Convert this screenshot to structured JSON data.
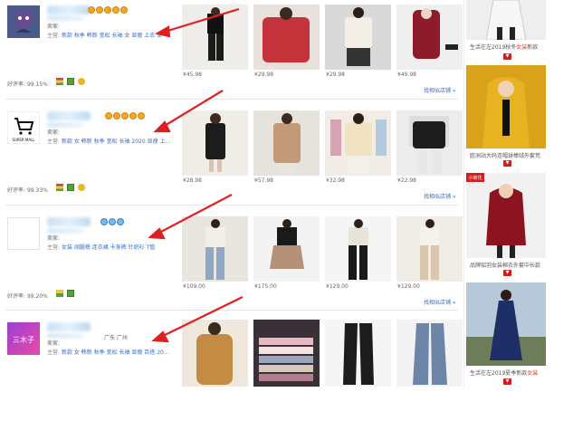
{
  "shops": [
    {
      "seller_label": "卖家:",
      "main_label": "主营:",
      "main_keywords": "新款 秋季 韩新 宽松 长袖 女 显瘦 上衣 女",
      "rating_label": "好评率:",
      "rating_value": "99.15%",
      "location": "",
      "more_link": "",
      "prices": [
        "¥45.98",
        "¥29.98",
        "¥29.98",
        "¥49.98"
      ]
    },
    {
      "seller_label": "卖家:",
      "main_label": "主营:",
      "main_keywords": "新款 女 韩新 秋季 宽松 长袖 2020 显瘦 上...",
      "rating_label": "好评率:",
      "rating_value": "99.33%",
      "location": "",
      "more_link": "找相似店铺 »",
      "prices": [
        "¥28.98",
        "¥57.98",
        "¥32.98",
        "¥22.98"
      ]
    },
    {
      "seller_label": "卖家:",
      "main_label": "主营:",
      "main_keywords": "女装 阔腿裤 连衣裙 卡身裤 针织衫 T恤",
      "rating_label": "好评率:",
      "rating_value": "99.20%",
      "location": "",
      "more_link": "找相似店铺 »",
      "prices": [
        "¥109.00",
        "¥175.00",
        "¥129.00",
        "¥129.00"
      ]
    },
    {
      "seller_label": "卖家:",
      "main_label": "主营:",
      "main_keywords": "新款 女 韩新 秋季 宽松 长袖 显瘦 百搭 20...",
      "rating_label": "",
      "rating_value": "",
      "location": "广东 广州",
      "more_link": "",
      "prices": []
    }
  ],
  "shop1_more": "找相似店铺 »",
  "logo_texts": {
    "super_mall": "SUPER MALL",
    "sanmuzi": "三木子"
  },
  "sidebar": [
    {
      "caption_pre": "生活在左2019秋冬",
      "caption_hl": "女装",
      "caption_post": "新款"
    },
    {
      "caption_pre": "",
      "caption_hl": "",
      "caption_post": "欧洲站大码连帽球棒绒外套荒",
      "tag": "小荷花"
    },
    {
      "caption_pre": "",
      "caption_hl": "",
      "caption_post": "品牌貂羽女装棉衣外套中长款"
    },
    {
      "caption_pre": "生活在左2019夏季新款",
      "caption_hl": "女装",
      "caption_post": ""
    }
  ],
  "colors": {
    "link": "#3a6cc4",
    "arrow": "#e02020",
    "sidebar_tab": "#d21d1d",
    "highlight": "#e4393c"
  }
}
